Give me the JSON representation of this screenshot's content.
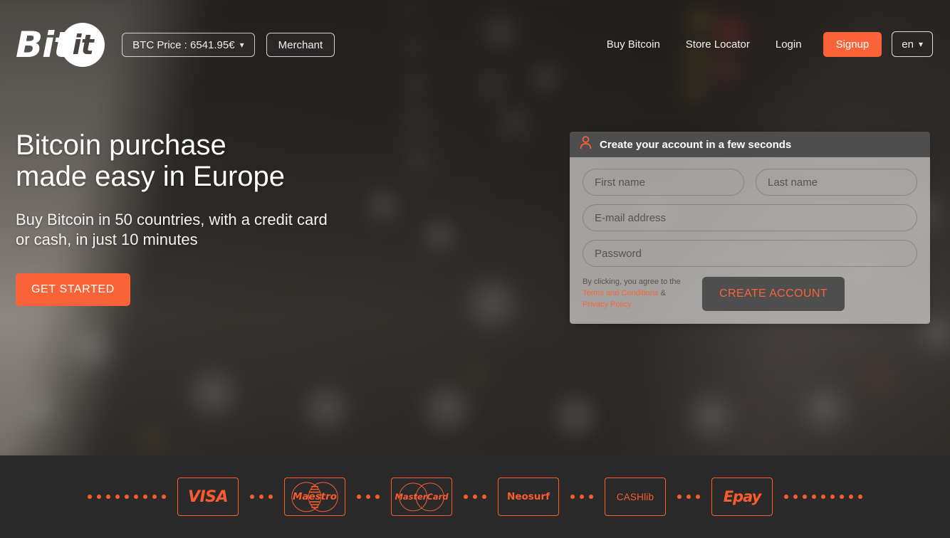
{
  "header": {
    "logo": {
      "word": "Bit",
      "badge": "it",
      "name": "Bitit"
    },
    "btc_price": {
      "label": "BTC Price : 6541.95€",
      "caret": "chevron-down-icon"
    },
    "merchant_label": "Merchant",
    "nav": [
      {
        "label": "Buy Bitcoin"
      },
      {
        "label": "Store Locator"
      },
      {
        "label": "Login"
      }
    ],
    "signup_label": "Signup",
    "language": {
      "value": "en",
      "caret": "chevron-down-icon"
    }
  },
  "hero": {
    "title_line1": "Bitcoin purchase",
    "title_line2": "made easy in Europe",
    "subtitle_line1": "Buy Bitcoin in 50 countries, with a credit card",
    "subtitle_line2": "or cash, in just 10 minutes",
    "cta_label": "GET STARTED"
  },
  "signup_panel": {
    "header_icon": "user-icon",
    "header_title": "Create your account in a few seconds",
    "fields": {
      "first_name_placeholder": "First name",
      "last_name_placeholder": "Last name",
      "email_placeholder": "E-mail address",
      "password_placeholder": "Password"
    },
    "terms": {
      "prefix": "By clicking, you agree to the ",
      "link1": "Terms and Conditions",
      "separator": " & ",
      "link2": "Privacy Policy"
    },
    "submit_label": "CREATE ACCOUNT"
  },
  "footer": {
    "payment_methods": [
      {
        "name": "visa",
        "label": "VISA"
      },
      {
        "name": "maestro",
        "label": "Maestro"
      },
      {
        "name": "mastercard",
        "label": "MasterCard"
      },
      {
        "name": "neosurf",
        "label": "Neosurf"
      },
      {
        "name": "cashlib",
        "label": "CASHlib"
      },
      {
        "name": "epay",
        "label": "Epay"
      }
    ]
  },
  "colors": {
    "accent": "#FA6338",
    "accent_footer": "#FA5C2E",
    "panel_header": "#4E4E4E",
    "footer_bg": "#2A2A2A"
  }
}
